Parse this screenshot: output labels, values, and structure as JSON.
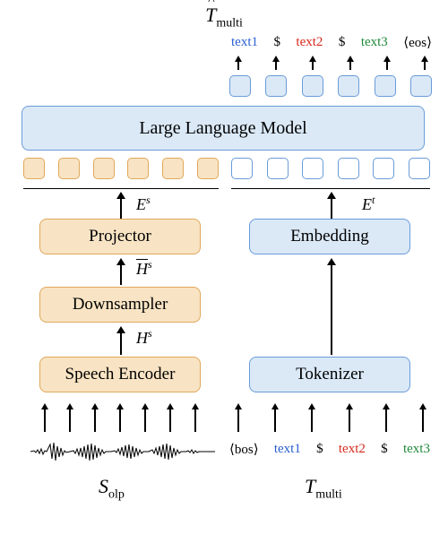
{
  "top_symbol_base": "T",
  "top_symbol_sub": "multi",
  "output_tokens": [
    "text1",
    "$",
    "text2",
    "$",
    "text3",
    "⟨eos⟩"
  ],
  "output_colors": [
    "#2a5fd0",
    "#000",
    "#d62a1e",
    "#000",
    "#1f8a3a",
    "#000"
  ],
  "llm_label": "Large Language Model",
  "e_s": "E",
  "e_s_sup": "s",
  "e_t": "E",
  "e_t_sup": "t",
  "hbar": "H",
  "hbar_sup": "s",
  "hs": "H",
  "hs_sup": "s",
  "projector": "Projector",
  "downsampler": "Downsampler",
  "speech_encoder": "Speech Encoder",
  "embedding": "Embedding",
  "tokenizer": "Tokenizer",
  "input_tokens": [
    "⟨bos⟩",
    "text1",
    "$",
    "text2",
    "$",
    "text3"
  ],
  "input_colors": [
    "#000",
    "#2a5fd0",
    "#000",
    "#d62a1e",
    "#000",
    "#1f8a3a"
  ],
  "cap_left_base": "S",
  "cap_left_sub": "olp",
  "cap_right_base": "T",
  "cap_right_sub": "multi",
  "colors": {
    "blue": "#2a5fd0",
    "red": "#d62a1e",
    "green": "#1f8a3a"
  }
}
